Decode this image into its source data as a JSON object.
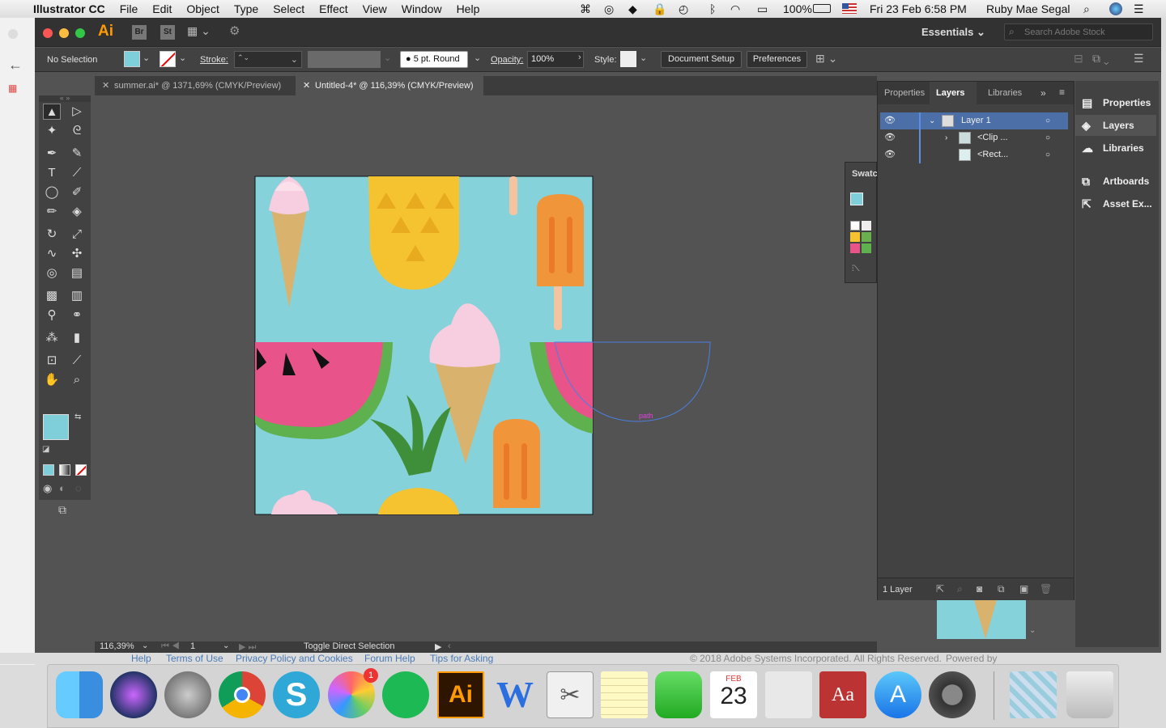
{
  "menubar": {
    "app": "Illustrator CC",
    "items": [
      "File",
      "Edit",
      "Object",
      "Type",
      "Select",
      "Effect",
      "View",
      "Window",
      "Help"
    ],
    "battery": "100%",
    "datetime": "Fri 23 Feb  6:58 PM",
    "user": "Ruby Mae Segal"
  },
  "appbar": {
    "logo": "Ai",
    "bridge": "Br",
    "stock": "St",
    "workspace": "Essentials",
    "search_placeholder": "Search Adobe Stock"
  },
  "control": {
    "selection": "No Selection",
    "stroke_label": "Stroke:",
    "brush": "5 pt. Round",
    "opacity_label": "Opacity:",
    "opacity_value": "100%",
    "style_label": "Style:",
    "document_setup": "Document Setup",
    "preferences": "Preferences"
  },
  "tabs": [
    {
      "label": "summer.ai* @ 1371,69% (CMYK/Preview)"
    },
    {
      "label": "Untitled-4* @ 116,39% (CMYK/Preview)"
    }
  ],
  "canvas": {
    "path_label": "path"
  },
  "status": {
    "zoom": "116,39%",
    "artboard": "1",
    "hint": "Toggle Direct Selection"
  },
  "swatches_tab": "Swatc",
  "layers_panel": {
    "tabs": [
      "Properties",
      "Layers",
      "Libraries"
    ],
    "rows": [
      {
        "name": "Layer 1"
      },
      {
        "name": "<Clip ..."
      },
      {
        "name": "<Rect..."
      }
    ],
    "count": "1 Layer"
  },
  "dock_panels": {
    "items": [
      "Properties",
      "Layers",
      "Libraries",
      "Artboards",
      "Asset Ex..."
    ]
  },
  "footer": {
    "links": [
      "Help",
      "Terms of Use",
      "Privacy Policy and Cookies",
      "Forum Help",
      "Tips for Asking"
    ],
    "copyright": "© 2018 Adobe Systems Incorporated. All Rights Reserved.",
    "powered": "Powered by"
  },
  "dock": {
    "calendar_month": "FEB",
    "calendar_day": "23",
    "photos_badge": "1",
    "ai_label": "Ai",
    "dict_label": "Aa"
  },
  "colors": {
    "fill_swatch": "#7ecfd9",
    "artboard_bg": "#85d2da",
    "watermelon": "#e8548a",
    "rind": "#5fb04f",
    "cone": "#d9b36e",
    "popsicle": "#f0953a",
    "pineapple": "#f5c230",
    "cream": "#f7cde0"
  }
}
